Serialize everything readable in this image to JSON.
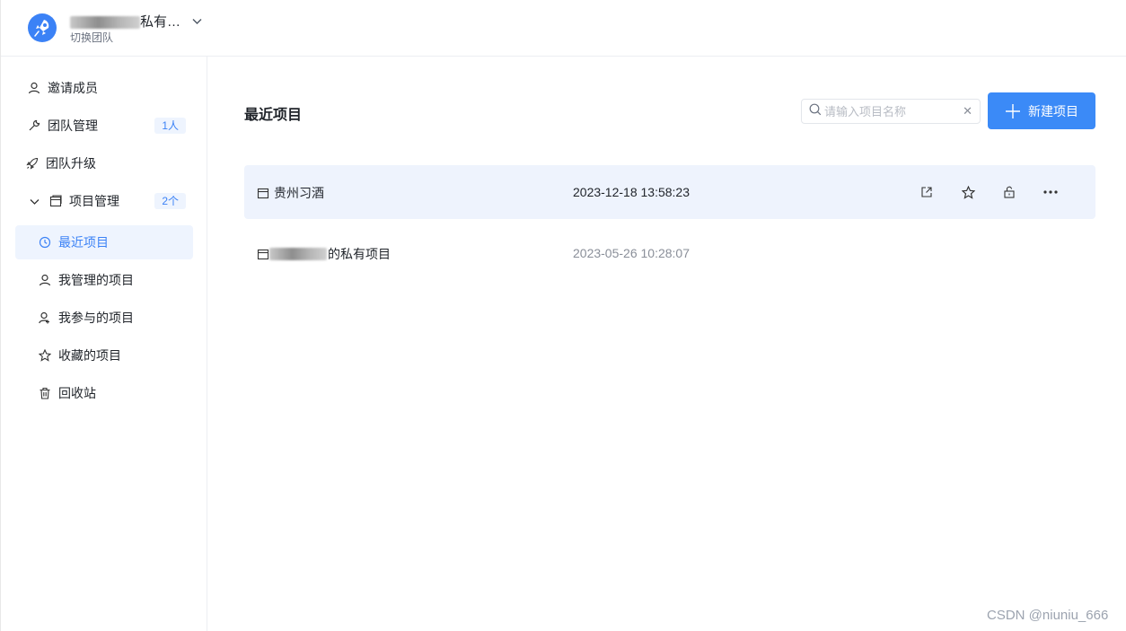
{
  "header": {
    "team_name_suffix": "私有…",
    "switch_label": "切换团队",
    "logo_icon": "rocket-icon",
    "chevron_icon": "chevron-down-icon"
  },
  "sidebar": {
    "items": [
      {
        "label": "邀请成员",
        "icon": "user-icon"
      },
      {
        "label": "团队管理",
        "icon": "wrench-icon",
        "badge": "1人"
      },
      {
        "label": "团队升级",
        "icon": "rocket-icon"
      },
      {
        "label": "项目管理",
        "icon": "folder-icon",
        "badge": "2个",
        "expanded": true
      },
      {
        "label": "最近项目",
        "icon": "clock-icon",
        "active": true
      },
      {
        "label": "我管理的项目",
        "icon": "user-icon"
      },
      {
        "label": "我参与的项目",
        "icon": "user-plus-icon"
      },
      {
        "label": "收藏的项目",
        "icon": "star-icon"
      },
      {
        "label": "回收站",
        "icon": "trash-icon"
      }
    ]
  },
  "main": {
    "title": "最近项目",
    "search": {
      "placeholder": "请输入项目名称",
      "value": ""
    },
    "new_button": "新建项目",
    "projects": [
      {
        "name": "贵州习酒",
        "time": "2023-12-18 13:58:23"
      },
      {
        "name_suffix": "的私有项目",
        "time": "2023-05-26 10:28:07"
      }
    ],
    "row_actions": [
      "external-link-icon",
      "star-icon",
      "unlock-icon",
      "more-icon"
    ]
  },
  "watermark": "CSDN @niuniu_666",
  "colors": {
    "accent": "#3b8af7",
    "active_bg": "#eef4fe",
    "hover_row": "#eef3fd"
  }
}
